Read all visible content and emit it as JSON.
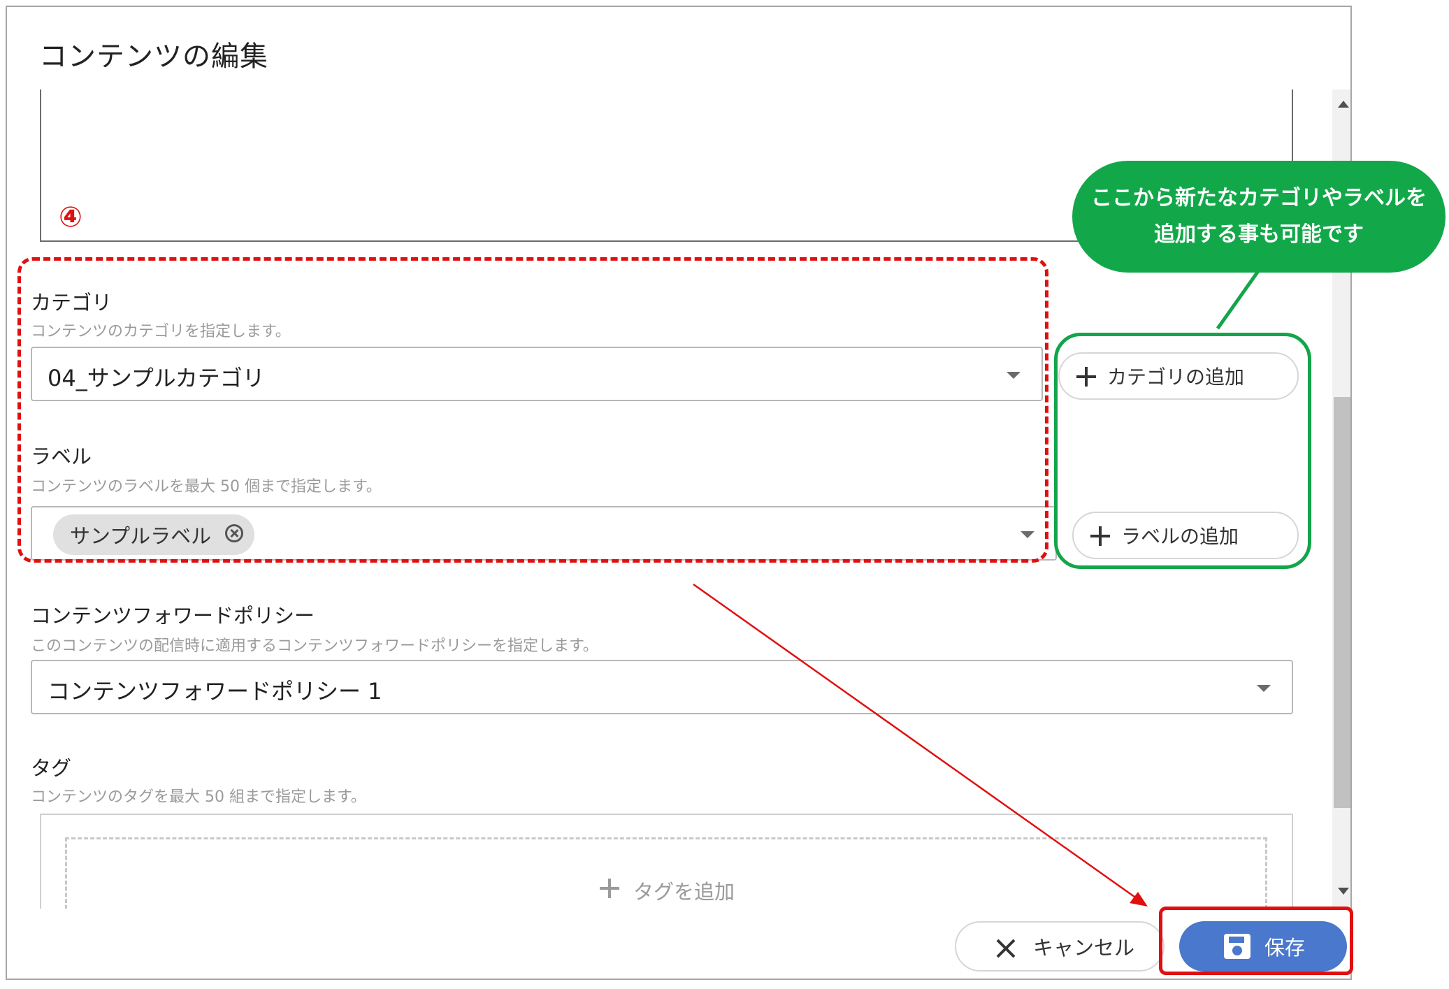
{
  "dialog": {
    "title": "コンテンツの編集"
  },
  "category": {
    "label": "カテゴリ",
    "help": "コンテンツのカテゴリを指定します。",
    "value": "04_サンプルカテゴリ",
    "add_button": "カテゴリの追加"
  },
  "label_field": {
    "label": "ラベル",
    "help": "コンテンツのラベルを最大 50 個まで指定します。",
    "chips": [
      "サンプルラベル"
    ],
    "add_button": "ラベルの追加"
  },
  "policy": {
    "label": "コンテンツフォワードポリシー",
    "help": "このコンテンツの配信時に適用するコンテンツフォワードポリシーを指定します。",
    "value": "コンテンツフォワードポリシー 1"
  },
  "tag": {
    "label": "タグ",
    "help": "コンテンツのタグを最大 50 組まで指定します。",
    "add_label": "タグを追加"
  },
  "footer": {
    "cancel_label": "キャンセル",
    "save_label": "保存"
  },
  "annotations": {
    "number": "④",
    "bubble_line1": "ここから新たなカテゴリやラベルを",
    "bubble_line2": "追加する事も可能です",
    "red_color": "#e01010",
    "green_color": "#12a84a"
  },
  "icons": {
    "add": "plus-icon",
    "remove_chip": "circle-x-icon",
    "dropdown": "caret-down-icon",
    "cancel": "close-icon",
    "save": "floppy-disk-icon"
  }
}
